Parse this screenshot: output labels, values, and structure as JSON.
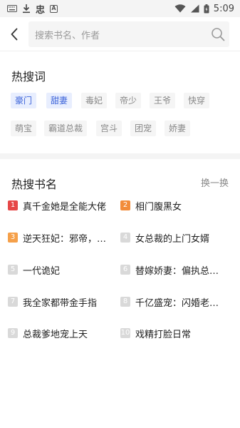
{
  "status_bar": {
    "left_icons": [
      "keyboard-icon",
      "download-icon",
      "chinese-app-icon",
      "a-box-icon"
    ],
    "app_glyph": "忠",
    "a_glyph": "A",
    "time": "5:09"
  },
  "search": {
    "placeholder": "搜索书名、作者"
  },
  "hot_words": {
    "title": "热搜词",
    "tags": [
      {
        "label": "豪门",
        "active": true
      },
      {
        "label": "甜妻",
        "active": true
      },
      {
        "label": "毒妃",
        "active": false
      },
      {
        "label": "帝少",
        "active": false
      },
      {
        "label": "王爷",
        "active": false
      },
      {
        "label": "快穿",
        "active": false
      },
      {
        "label": "萌宝",
        "active": false
      },
      {
        "label": "霸道总裁",
        "active": false
      },
      {
        "label": "宫斗",
        "active": false
      },
      {
        "label": "团宠",
        "active": false
      },
      {
        "label": "娇妻",
        "active": false
      }
    ]
  },
  "hot_books": {
    "title": "热搜书名",
    "swap_label": "换一换",
    "items": [
      {
        "rank": "1",
        "name": "真千金她是全能大佬"
      },
      {
        "rank": "2",
        "name": "相门腹黑女"
      },
      {
        "rank": "3",
        "name": "逆天狂妃：邪帝，用..."
      },
      {
        "rank": "4",
        "name": "女总裁的上门女婿"
      },
      {
        "rank": "5",
        "name": "一代诡妃"
      },
      {
        "rank": "6",
        "name": "替嫁娇妻：偏执总裁..."
      },
      {
        "rank": "7",
        "name": "我全家都带金手指"
      },
      {
        "rank": "8",
        "name": "千亿盛宠：闪婚老公..."
      },
      {
        "rank": "9",
        "name": "总裁爹地宠上天"
      },
      {
        "rank": "10",
        "name": "戏精打脸日常"
      }
    ]
  },
  "colors": {
    "active_tag_bg": "#e8eefe",
    "active_tag_text": "#3b63d9",
    "rank_1": "#e64848",
    "rank_2": "#f28c3a",
    "rank_3": "#f5a04a",
    "rank_other": "#d9d9d9"
  }
}
